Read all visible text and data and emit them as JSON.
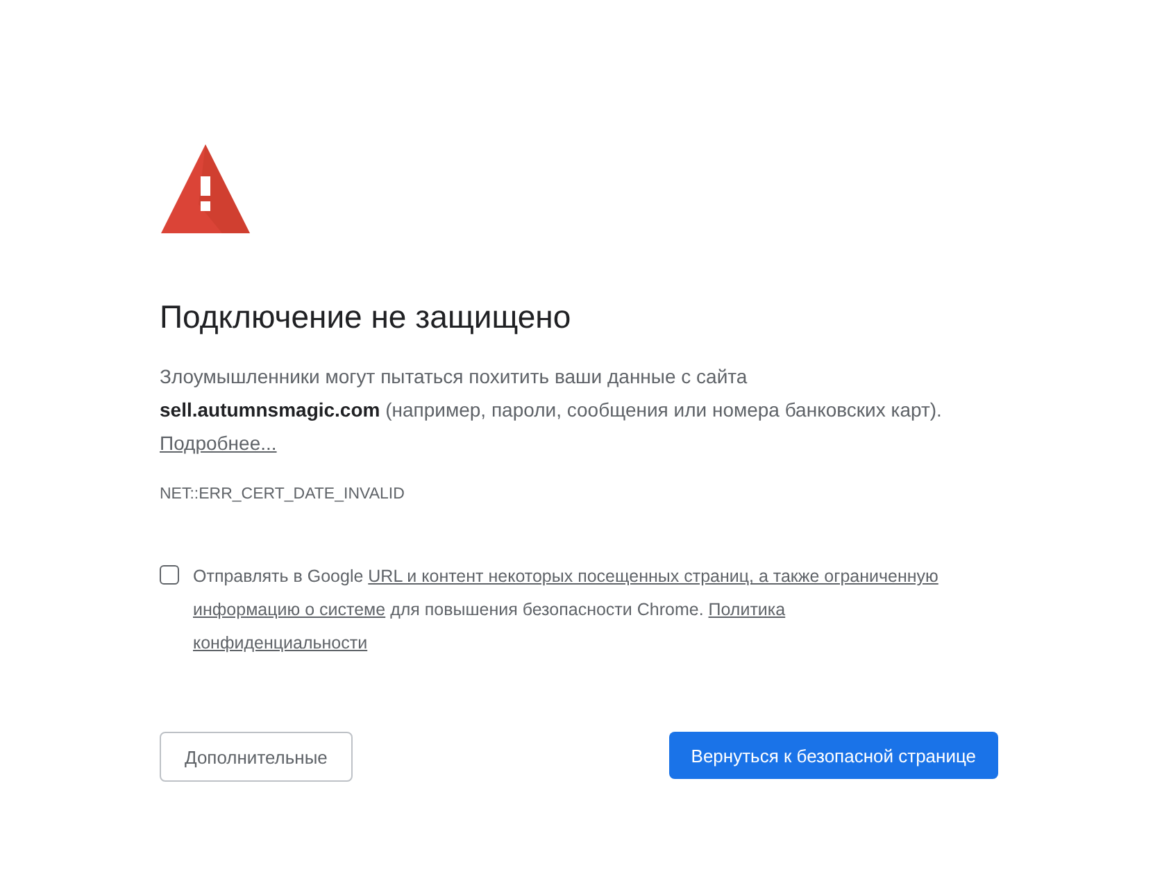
{
  "heading": "Подключение не защищено",
  "message": {
    "intro": "Злоумышленники могут пытаться похитить ваши данные с сайта",
    "site": "sell.autumnsmagic.com",
    "rest": "(например, пароли, сообщения или номера банковских карт)."
  },
  "details_link": "Подробнее...",
  "error_code": "NET::ERR_CERT_DATE_INVALID",
  "opt_in": {
    "checked": false,
    "segments": [
      {
        "kind": "text",
        "text": "Отправлять в Google "
      },
      {
        "kind": "link",
        "text": "URL и контент некоторых посещенных страниц, а также ограниченную"
      },
      {
        "kind": "link",
        "text": "информацию о системе"
      },
      {
        "kind": "text",
        "text": " для повышения безопасности Chrome. "
      },
      {
        "kind": "link",
        "text": "Политика"
      },
      {
        "kind": "link",
        "text": "конфиденциальности"
      }
    ]
  },
  "buttons": [
    {
      "label": "Дополнительные",
      "kind": "secondary"
    },
    {
      "label": "Вернуться к безопасной странице",
      "kind": "primary"
    }
  ]
}
